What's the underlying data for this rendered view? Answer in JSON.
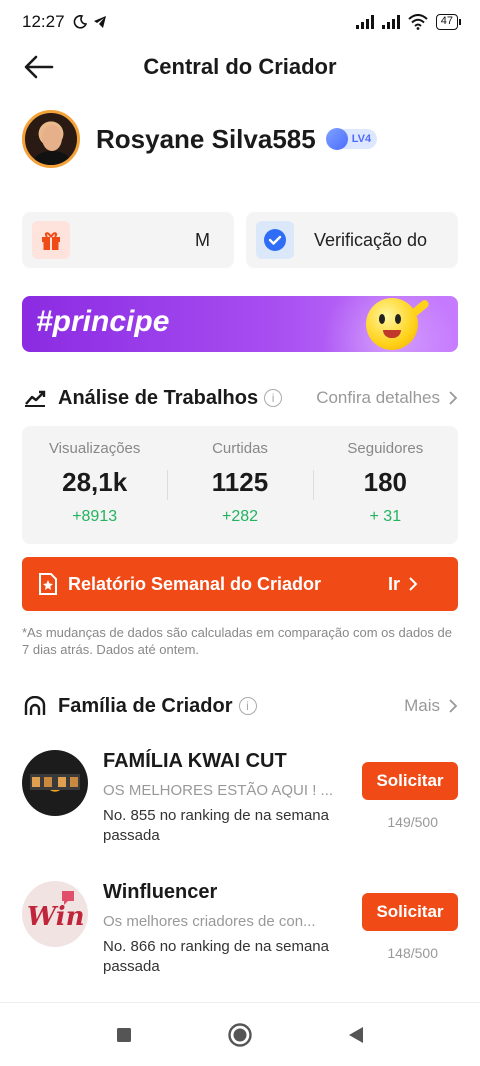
{
  "status_bar": {
    "time": "12:27",
    "battery": "47"
  },
  "header": {
    "title": "Central do Criador"
  },
  "profile": {
    "name": "Rosyane Silva585",
    "level": "LV4"
  },
  "cards": [
    {
      "label": "M",
      "icon": "gift-icon"
    },
    {
      "label": "Verificação do",
      "icon": "check-circle-icon"
    }
  ],
  "banner": {
    "tag": "#principe"
  },
  "analysis": {
    "title": "Análise de Trabalhos",
    "more": "Confira detalhes",
    "stats": [
      {
        "label": "Visualizações",
        "value": "28,1k",
        "delta": "+8913"
      },
      {
        "label": "Curtidas",
        "value": "1125",
        "delta": "+282"
      },
      {
        "label": "Seguidores",
        "value": "180",
        "delta": "+ 31"
      }
    ],
    "report_label": "Relatório Semanal do Criador",
    "report_go": "Ir",
    "note": "*As mudanças de dados são calculadas em comparação com os dados de 7 dias atrás. Dados até ontem."
  },
  "family": {
    "title": "Família de Criador",
    "more": "Mais",
    "items": [
      {
        "name": "FAMÍLIA KWAI CUT",
        "desc": "OS MELHORES ESTÃO AQUI ! ...",
        "rank": "No. 855 no ranking de na semana passada",
        "button": "Solicitar",
        "count": "149/500"
      },
      {
        "name": "Winfluencer",
        "desc": "Os melhores criadores de con...",
        "rank": "No. 866 no ranking de na semana passada",
        "button": "Solicitar",
        "count": "148/500"
      }
    ]
  },
  "colors": {
    "accent": "#f04a16",
    "positive": "#22b35e",
    "banner": "#a64cf0"
  }
}
